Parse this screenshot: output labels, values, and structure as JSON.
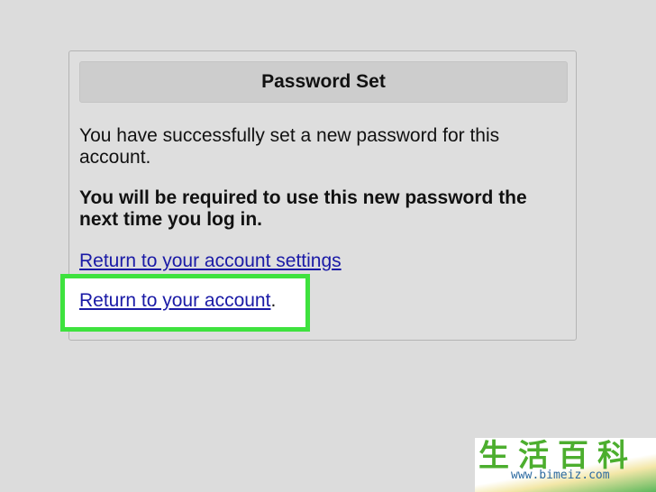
{
  "panel": {
    "title": "Password Set",
    "message_1": "You have successfully set a new password for this account.",
    "message_2": "You will be required to use this new password the next time you log in.",
    "link_settings": "Return to your account settings",
    "link_account": "Return to your account",
    "link_account_suffix": "."
  },
  "watermark": {
    "chinese_text": "生活百科",
    "url": "www.bimeiz.com"
  },
  "colors": {
    "highlight_border": "#3ee23e",
    "link": "#1a1aa6",
    "background": "#dcdcdc"
  }
}
